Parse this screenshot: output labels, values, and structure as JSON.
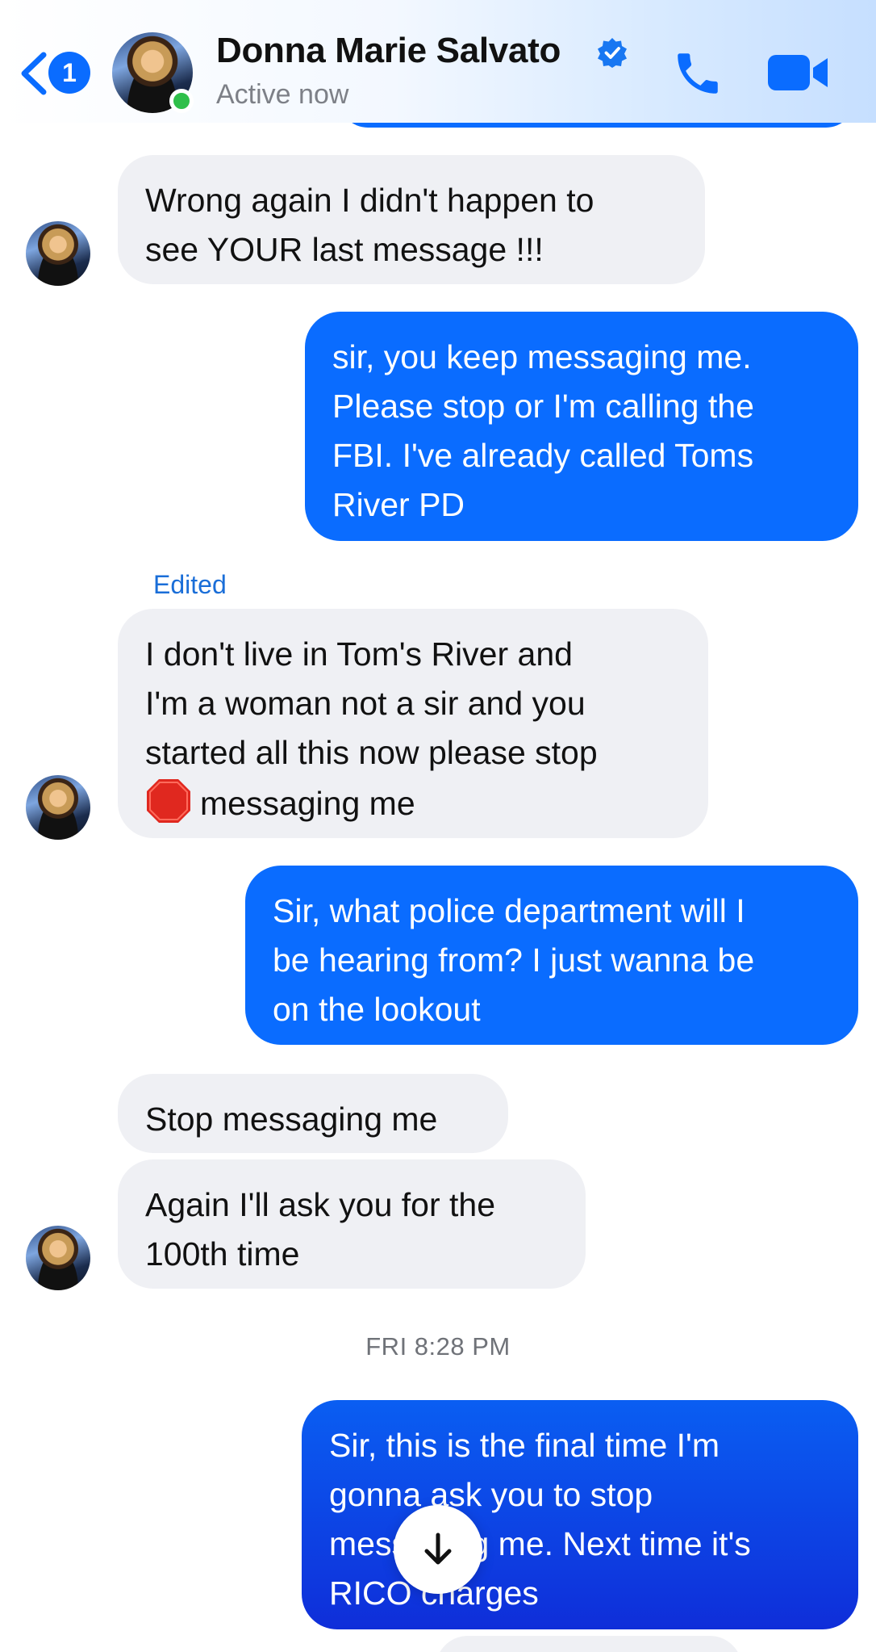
{
  "header": {
    "unread_count": "1",
    "contact_name": "Donna Marie Salvato",
    "status": "Active now"
  },
  "messages": [
    {
      "direction": "in",
      "lines": [
        "Wrong again I didn't happen to",
        "see YOUR last message !!!"
      ]
    },
    {
      "direction": "out",
      "lines": [
        "sir, you keep messaging me.",
        "Please stop or I'm calling the",
        "FBI. I've already called Toms",
        "River PD"
      ]
    },
    {
      "direction": "in",
      "edited_label": "Edited",
      "lines": [
        "I don't live in Tom's  River and",
        "I'm a woman not a sir and you",
        "started all this now please stop",
        "messaging me"
      ]
    },
    {
      "direction": "out",
      "lines": [
        "Sir, what police department will I",
        "be hearing from? I just wanna be",
        "on the lookout"
      ]
    },
    {
      "direction": "in",
      "lines": [
        "Stop messaging me"
      ]
    },
    {
      "direction": "in",
      "lines": [
        "Again I'll ask you for the",
        "100th time"
      ]
    },
    {
      "direction": "out",
      "lines": [
        "Sir, this is the final time I'm",
        "gonna ask you to stop",
        "messaging me. Next time it's",
        "RICO charges"
      ]
    }
  ],
  "timestamp": "FRI 8:28 PM",
  "icons": {
    "back": "chevron-left-icon",
    "verified": "verified-badge-icon",
    "call": "phone-icon",
    "video": "video-camera-icon",
    "scroll": "arrow-down-icon",
    "emoji": "stop-sign-emoji"
  },
  "colors": {
    "accent": "#0a6cff",
    "incoming_bubble": "#eff0f4",
    "online": "#2fbf4a"
  }
}
